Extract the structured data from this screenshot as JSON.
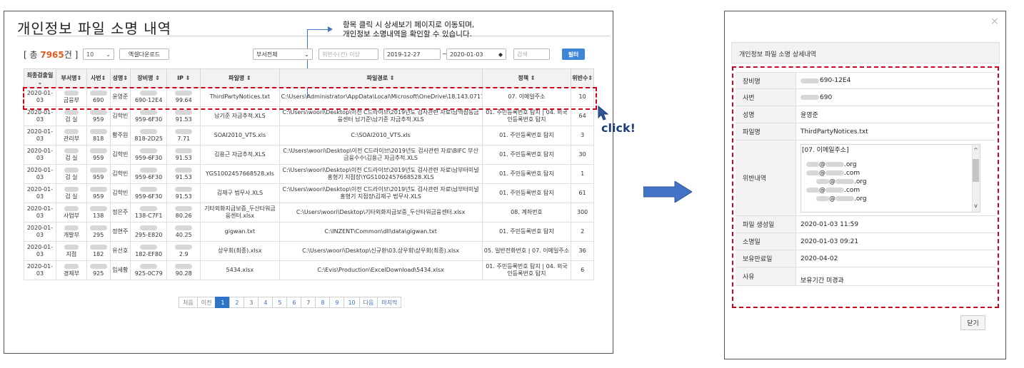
{
  "list": {
    "title": "개인정보 파일 소명 내역",
    "annotation": [
      "항목 클릭 시 상세보기 페이지로 이동되며,",
      "개인정보 소명내역을 확인할 수 있습니다."
    ],
    "total_prefix": "[ 총 ",
    "total_value": "7965",
    "total_suffix": "건 ]",
    "page_size": "10",
    "excel_button": "엑셀다운로드",
    "dept_select": "부서전체",
    "violation_placeholder": "위반수(건) 이상",
    "date_from": "2019-12-27",
    "date_sep": "~",
    "date_to": "2020-01-03",
    "search_placeholder": "검색",
    "filter_button": "필터",
    "columns": [
      "최종검출일",
      "부서명",
      "사번",
      "성명",
      "장비명",
      "IP",
      "파일명",
      "파일경로",
      "정책",
      "위반수"
    ],
    "rows": [
      {
        "date": "2020-01-03",
        "dept": "금융부",
        "emp": "690",
        "name": "윤영준",
        "device": "690-12E4",
        "ip": "99.64",
        "file": "ThirdPartyNotices.txt",
        "path": "C:\\Users\\Administrator\\AppData\\Local\\Microsoft\\OneDrive\\18.143.0717.0002\\ThirdPartyNotices.txt",
        "policy": "07. 이메일주소",
        "count": "10"
      },
      {
        "date": "2020-01-03",
        "dept": "검 실",
        "emp": "959",
        "name": "김학빈",
        "device": "959-6F30",
        "ip": "91.53",
        "file": "남기준 자금추적.XLS",
        "path": "C:\\Users\\woori\\Desktop\\이전 C드라이브\\2019년도 검사관련 자료\\남역삼동금융센터 남기준\\남기준 자금추적.XLS",
        "policy": "01. 주민등록번호 탐지|04. 외국인등록번호 탐지",
        "count": "64"
      },
      {
        "date": "2020-01-03",
        "dept": "관리부",
        "emp": "818",
        "name": "황주원",
        "device": "818-2D25",
        "ip": "7.71",
        "file": "SOAI2010_VTS.xls",
        "path": "C:\\SOAI2010_VTS.xls",
        "policy": "01. 주민등록번호 탐지",
        "count": "3"
      },
      {
        "date": "2020-01-03",
        "dept": "검 실",
        "emp": "959",
        "name": "김학빈",
        "device": "959-6F30",
        "ip": "91.53",
        "file": "김용근 자금추적.XLS",
        "path": "C:\\Users\\woori\\Desktop\\이전 C드라이브\\2019년도 검사관련 자료\\BIFC 부산 금융수수\\김용근 자금추적.XLS",
        "policy": "01. 주민등록번호 탐지",
        "count": "30"
      },
      {
        "date": "2020-01-03",
        "dept": "검 실",
        "emp": "959",
        "name": "김학빈",
        "device": "959-6F30",
        "ip": "91.53",
        "file": "YGS1002457668528.xls",
        "path": "C:\\Users\\woori\\Desktop\\이전 C드라이브\\2019년도 검사관련 자료\\남부터미널 홍형기 지점장\\YGS1002457668528.XLS",
        "policy": "01. 주민등록번호 탐지",
        "count": "1"
      },
      {
        "date": "2020-01-03",
        "dept": "검 실",
        "emp": "959",
        "name": "김학빈",
        "device": "959-6F30",
        "ip": "91.53",
        "file": "김재구 법무사.XLS",
        "path": "C:\\Users\\woori\\Desktop\\이전 C드라이브\\2019년도 검사관련 자료\\남부터미널 홍형기 지점장\\김재구 법무사.XLS",
        "policy": "01. 주민등록번호 탐지",
        "count": "61"
      },
      {
        "date": "2020-01-03",
        "dept": "사업부",
        "emp": "138",
        "name": "정은주",
        "device": "138-C7F1",
        "ip": "80.26",
        "file": "기타외화지급보증_두산타워금융센터.xlsx",
        "path": "C:\\Users\\woori\\Desktop\\기타외화지급보증_두산타워금융센터.xlsx",
        "policy": "08. 계좌번호",
        "count": "300"
      },
      {
        "date": "2020-01-03",
        "dept": "개발부",
        "emp": "295",
        "name": "정현주",
        "device": "295-E820",
        "ip": "40.25",
        "file": "gigwan.txt",
        "path": "C:\\INZENT\\Common\\dll\\data\\gigwan.txt",
        "policy": "01. 주민등록번호 탐지",
        "count": "2"
      },
      {
        "date": "2020-01-03",
        "dept": "지점",
        "emp": "182",
        "name": "유선호",
        "device": "182-EF80",
        "ip": "2.9",
        "file": "상우회(최종).xlsx",
        "path": "C:\\Users\\woori\\Desktop\\신규환\\03.상우회\\상우회(최종).xlsx",
        "policy": "05. 일반전화번호|07. 이메일주소",
        "count": "36"
      },
      {
        "date": "2020-01-03",
        "dept": "경제부",
        "emp": "925",
        "name": "임세황",
        "device": "925-0C79",
        "ip": "90.28",
        "file": "5434.xlsx",
        "path": "C:\\Evis\\Production\\ExcelDownload\\5434.xlsx",
        "policy": "01. 주민등록번호 탐지|04. 외국인등록번호 탐지",
        "count": "6"
      }
    ],
    "pagination": [
      "처음",
      "이전",
      "1",
      "2",
      "3",
      "4",
      "5",
      "6",
      "7",
      "8",
      "9",
      "10",
      "다음",
      "마지막"
    ],
    "active_page": "1",
    "click_label": "click!"
  },
  "detail": {
    "header": "개인정보 파일 소명 상세내역",
    "close_x": "×",
    "rows": [
      {
        "key": "장비명",
        "value": "690-12E4"
      },
      {
        "key": "사번",
        "value": "690"
      },
      {
        "key": "성명",
        "value": "윤영준"
      },
      {
        "key": "파일명",
        "value": "ThirdPartyNotices.txt"
      },
      {
        "key": "위반내역",
        "value": ""
      },
      {
        "key": "파일 생성일",
        "value": "2020-01-03 11:59"
      },
      {
        "key": "소명일",
        "value": "2020-01-03 09:21"
      },
      {
        "key": "보유만료일",
        "value": "2020-04-02"
      },
      {
        "key": "사유",
        "value": "보유기간 미경과"
      }
    ],
    "violations_heading": "[07. 이메일주소]",
    "violations": [
      ".org",
      ".com",
      ".org",
      ".com",
      ".org"
    ],
    "close_button": "닫기"
  },
  "colors": {
    "accent": "#2e75c7",
    "highlight": "#d0021b",
    "count": "#e25a1c"
  }
}
